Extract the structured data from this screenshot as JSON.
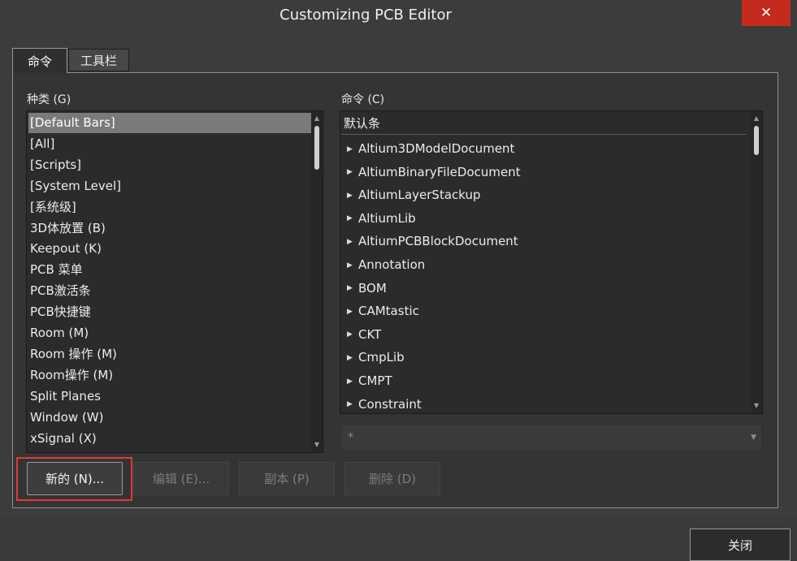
{
  "window": {
    "title": "Customizing PCB Editor",
    "close_glyph": "✕"
  },
  "tabs": [
    {
      "label": "命令",
      "active": true
    },
    {
      "label": "工具栏",
      "active": false
    }
  ],
  "categories": {
    "label": "种类 (G)",
    "selected_index": 0,
    "items": [
      "[Default Bars]",
      "[All]",
      "[Scripts]",
      "[System Level]",
      "[系统级]",
      "3D体放置 (B)",
      "Keepout (K)",
      "PCB 菜单",
      "PCB激活条",
      "PCB快捷键",
      "Room (M)",
      "Room 操作 (M)",
      "Room操作 (M)",
      "Split Planes",
      "Window (W)",
      "xSignal (X)"
    ]
  },
  "commands": {
    "label": "命令 (C)",
    "header": "默认条",
    "items": [
      "Altium3DModelDocument",
      "AltiumBinaryFileDocument",
      "AltiumLayerStackup",
      "AltiumLib",
      "AltiumPCBBlockDocument",
      "Annotation",
      "BOM",
      "CAMtastic",
      "CKT",
      "CmpLib",
      "CMPT",
      "Constraint"
    ],
    "filter_value": "*"
  },
  "buttons": [
    {
      "label": "新的 (N)...",
      "enabled": true,
      "highlighted": true
    },
    {
      "label": "编辑 (E)...",
      "enabled": false
    },
    {
      "label": "副本 (P)",
      "enabled": false
    },
    {
      "label": "删除 (D)",
      "enabled": false
    }
  ],
  "footer": {
    "close_label": "关闭"
  },
  "colors": {
    "accent_close": "#c42b1c",
    "highlight_box": "#e03a3a",
    "selected_row": "#7a7a7a"
  },
  "icons": {
    "close": "close-icon",
    "caret": "caret-right-icon",
    "dropdown": "chevron-down-icon"
  }
}
